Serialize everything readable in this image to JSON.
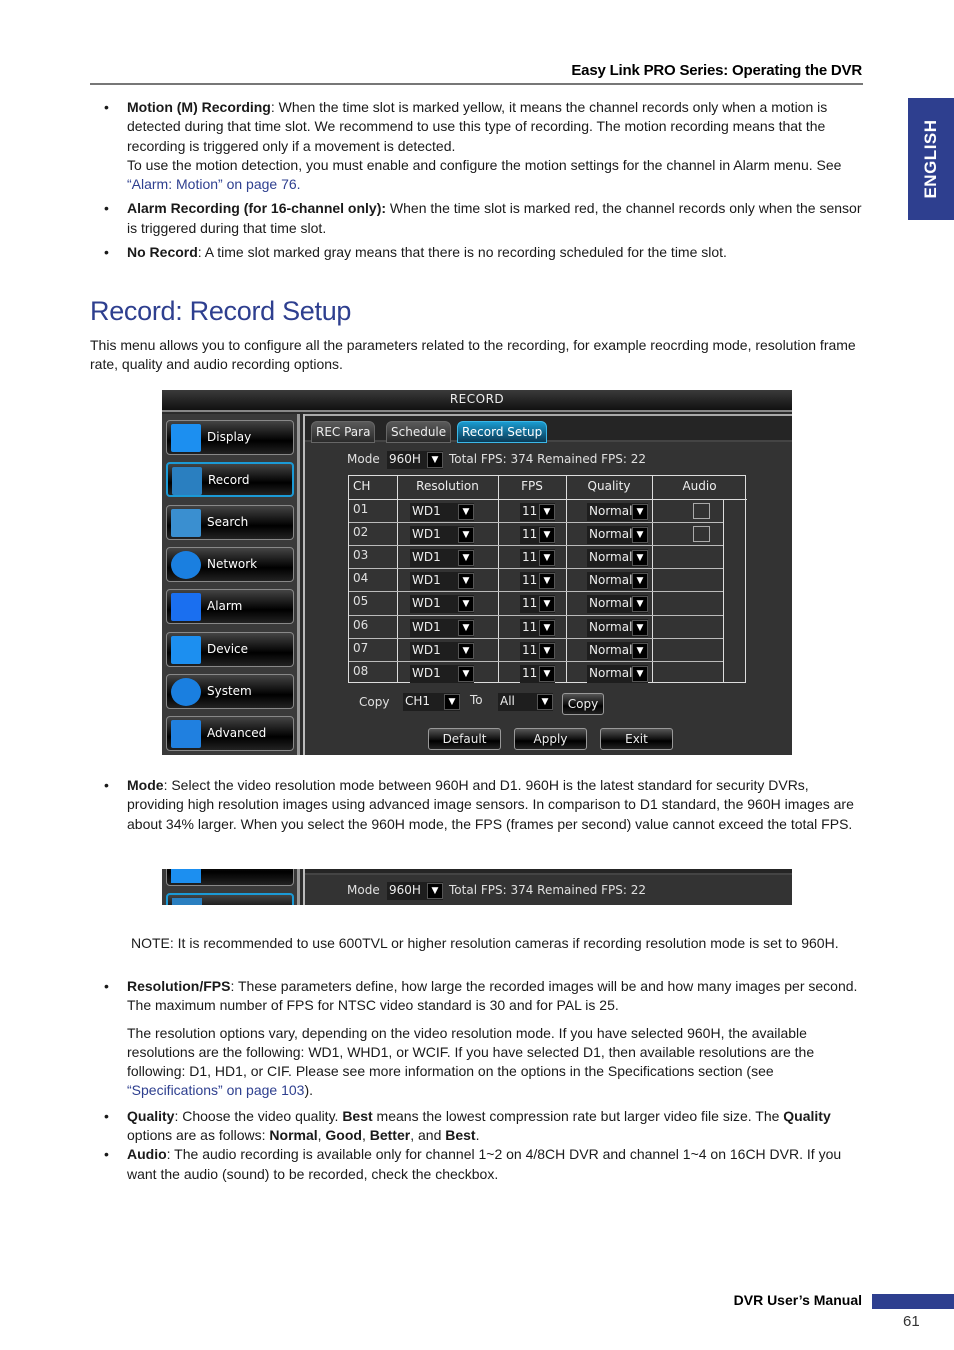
{
  "header": {
    "title": "Easy Link PRO Series: Operating the DVR",
    "language_tab": "ENGLISH"
  },
  "top_bullets": [
    {
      "term": "Motion (M) Recording",
      "text": ": When the time slot is marked yellow, it means the channel records only when a motion is detected during that time slot. We recommend to use this type of recording. The motion recording means that the recording is triggered only if a movement is detected.",
      "extra": "To use the motion detection, you must enable and configure the motion settings for the channel in Alarm menu. See ",
      "link": "“Alarm: Motion” on page 76."
    },
    {
      "term": "Alarm Recording (for 16-channel only):",
      "text": " When the time slot is marked red, the channel records only when the sensor is triggered during that time slot."
    },
    {
      "term": "No Record",
      "text": ": A time slot marked gray means that there is no recording scheduled for the time slot."
    }
  ],
  "section": {
    "title": "Record: Record Setup",
    "intro": "This menu allows you to configure all the parameters related to the recording, for example reocrding mode, resolution frame rate, quality and audio recording options."
  },
  "dvr": {
    "window_title": "RECORD",
    "sidebar": [
      {
        "label": "Display",
        "icon": "monitor-icon"
      },
      {
        "label": "Record",
        "icon": "film-record-icon",
        "active": true
      },
      {
        "label": "Search",
        "icon": "magnifier-icon"
      },
      {
        "label": "Network",
        "icon": "network-globe-icon"
      },
      {
        "label": "Alarm",
        "icon": "alarm-siren-icon"
      },
      {
        "label": "Device",
        "icon": "device-monitor-icon"
      },
      {
        "label": "System",
        "icon": "gear-icon"
      },
      {
        "label": "Advanced",
        "icon": "screwdriver-icon"
      }
    ],
    "tabs": [
      {
        "label": "REC Para"
      },
      {
        "label": "Schedule"
      },
      {
        "label": "Record Setup",
        "active": true
      }
    ],
    "mode_label": "Mode",
    "mode_value": "960H",
    "fps_info": "Total FPS: 374 Remained FPS: 22",
    "columns": [
      "CH",
      "Resolution",
      "FPS",
      "Quality",
      "Audio"
    ],
    "rows": [
      {
        "ch": "01",
        "resolution": "WD1",
        "fps": "11",
        "quality": "Normal",
        "audio": false,
        "has_audio": true
      },
      {
        "ch": "02",
        "resolution": "WD1",
        "fps": "11",
        "quality": "Normal",
        "audio": false,
        "has_audio": true
      },
      {
        "ch": "03",
        "resolution": "WD1",
        "fps": "11",
        "quality": "Normal",
        "has_audio": false
      },
      {
        "ch": "04",
        "resolution": "WD1",
        "fps": "11",
        "quality": "Normal",
        "has_audio": false
      },
      {
        "ch": "05",
        "resolution": "WD1",
        "fps": "11",
        "quality": "Normal",
        "has_audio": false
      },
      {
        "ch": "06",
        "resolution": "WD1",
        "fps": "11",
        "quality": "Normal",
        "has_audio": false
      },
      {
        "ch": "07",
        "resolution": "WD1",
        "fps": "11",
        "quality": "Normal",
        "has_audio": false
      },
      {
        "ch": "08",
        "resolution": "WD1",
        "fps": "11",
        "quality": "Normal",
        "has_audio": false
      }
    ],
    "copy_label": "Copy",
    "copy_from": "CH1",
    "to_label": "To",
    "copy_to": "All",
    "copy_button": "Copy",
    "buttons": {
      "default": "Default",
      "apply": "Apply",
      "exit": "Exit"
    }
  },
  "mode_bullet": {
    "term": "Mode",
    "text": ": Select the video resolution mode between 960H and D1. 960H is the latest standard for security DVRs, providing high resolution images using advanced image sensors. In comparison to D1 standard, the 960H images are about 34% larger. When you select the 960H mode, the FPS (frames per second) value cannot exceed the total FPS."
  },
  "note": "NOTE: It is recommended to use 600TVL or higher resolution cameras if recording resolution mode is set to 960H.",
  "resfps_bullet": {
    "term": "Resolution/FPS",
    "text": ": These parameters define, how large the recorded images will be and how many images per second. The maximum number of FPS for NTSC video standard is 30 and for PAL is 25.",
    "para": "The resolution options vary, depending on the video resolution mode. If you have selected 960H, the available resolutions are the following: WD1, WHD1, or WCIF. If you have selected D1, then available resolutions are the following: D1, HD1, or CIF. Please see more information on the options in the Specifications section (see ",
    "link": "“Specifications” on page 103",
    "tail": ")."
  },
  "quality_bullet": {
    "term": "Quality",
    "t1": ": Choose the video quality. ",
    "b1": "Best",
    "t2": " means the lowest compression rate but larger video file size. The ",
    "b2": "Quality",
    "t3": " options are as follows: ",
    "o1": "Normal",
    "s1": ", ",
    "o2": "Good",
    "s2": ", ",
    "o3": "Better",
    "s3": ", and ",
    "o4": "Best",
    "end": "."
  },
  "audio_bullet": {
    "term": "Audio",
    "text": ": The audio recording is available only for channel 1~2 on 4/8CH DVR and channel 1~4 on 16CH DVR. If you want the audio (sound) to be recorded, check the checkbox."
  },
  "footer": {
    "label": "DVR User’s Manual",
    "page": "61"
  }
}
